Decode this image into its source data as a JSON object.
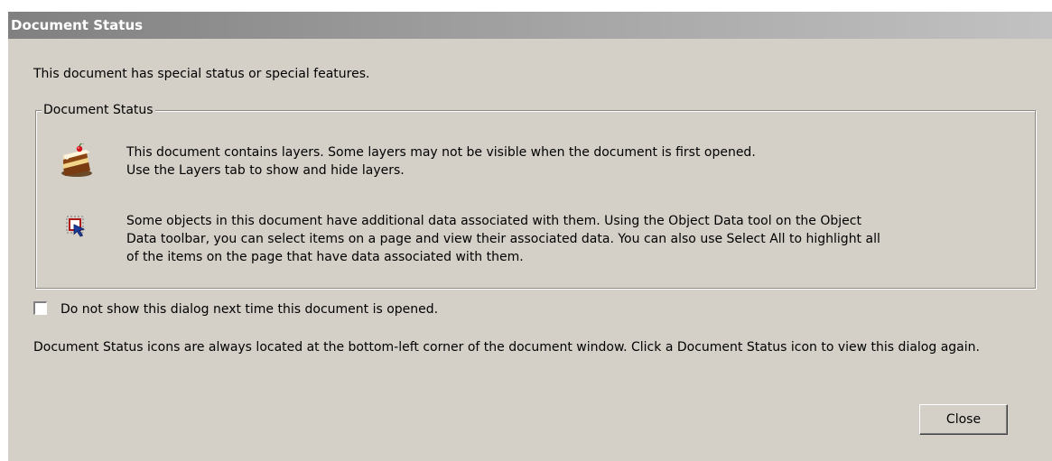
{
  "window": {
    "title": "Document Status"
  },
  "intro_text": "This document has special status or special features.",
  "group": {
    "legend": "Document Status",
    "items": [
      {
        "icon": "layers-cake-icon",
        "line1": "This document contains layers. Some layers may not be visible when the document is first opened.",
        "line2": "Use the Layers tab to show and hide layers."
      },
      {
        "icon": "object-data-icon",
        "line1": "Some objects in this document have additional data associated with them. Using the Object Data tool on the Object",
        "line2": "Data toolbar, you can select items on a page and view their associated data. You can also use Select All to highlight all",
        "line3": "of the items on the page that have data associated with them."
      }
    ]
  },
  "dont_show": {
    "label": "Do not show this dialog next time this document is opened.",
    "checked": false
  },
  "footnote": "Document Status icons are always located at the bottom-left corner of the document window. Click a Document Status icon to view this dialog again.",
  "buttons": {
    "close_label": "Close"
  }
}
